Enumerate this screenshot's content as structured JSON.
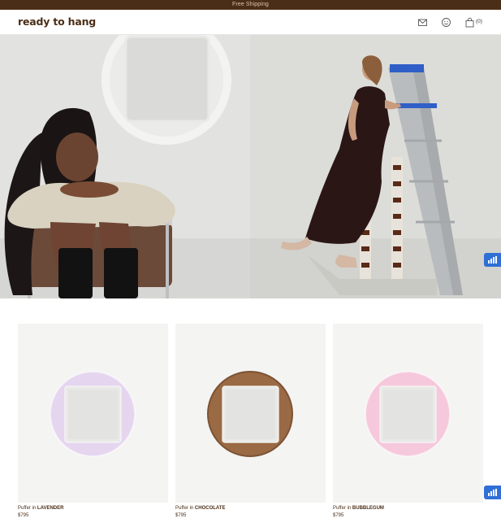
{
  "promo": {
    "text": "Free Shipping"
  },
  "header": {
    "logo": "ready to hang",
    "icons": [
      "mail-icon",
      "face-icon",
      "bag-icon"
    ],
    "cart_count": "(0)"
  },
  "hero": {
    "left_image": "woman seated on chair beneath round white mirror",
    "right_image": "woman in dark dress climbing a ladder"
  },
  "products": [
    {
      "prefix": "Puffer in ",
      "color_name": "LAVENDER",
      "price": "$795",
      "swatch": "#e5d5ef"
    },
    {
      "prefix": "Puffer in ",
      "color_name": "CHOCOLATE",
      "price": "$795",
      "swatch": "#9a6a44"
    },
    {
      "prefix": "Puffer in ",
      "color_name": "BUBBLEGUM",
      "price": "$795",
      "swatch": "#f6c8dc"
    }
  ],
  "colors": {
    "brand": "#4b2e17",
    "promo_text": "#d8c3a6",
    "chat": "#2f6fd6"
  }
}
